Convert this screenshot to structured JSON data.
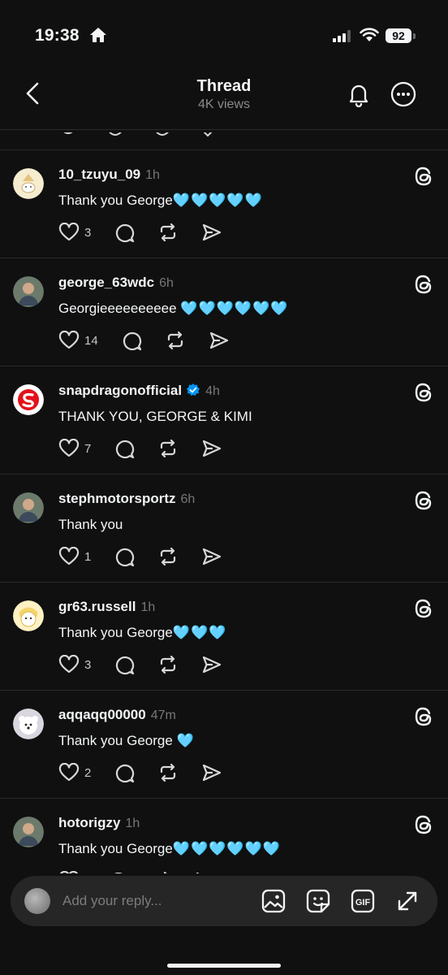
{
  "status": {
    "time": "19:38",
    "battery": "92"
  },
  "nav": {
    "title": "Thread",
    "subtitle": "4K views"
  },
  "posts": [
    {
      "username": "10_tzuyu_09",
      "time": "1h",
      "verified": false,
      "text": "Thank you George",
      "hearts": "🩵🩵🩵🩵🩵",
      "likes": "3",
      "avatar": "avatar-sketch"
    },
    {
      "username": "george_63wdc",
      "time": "6h",
      "verified": false,
      "text": "Georgieeeeeeeeee ",
      "hearts": "🩵🩵🩵🩵🩵🩵",
      "likes": "14",
      "avatar": "avatar-photo"
    },
    {
      "username": "snapdragonofficial",
      "time": "4h",
      "verified": true,
      "text": "THANK YOU, GEORGE & KIMI",
      "hearts": "",
      "likes": "7",
      "avatar": "snapdragon-logo"
    },
    {
      "username": "stephmotorsportz",
      "time": "6h",
      "verified": false,
      "text": "Thank you",
      "hearts": "",
      "likes": "1",
      "avatar": "avatar-photo"
    },
    {
      "username": "gr63.russell",
      "time": "1h",
      "verified": false,
      "text": "Thank you George",
      "hearts": "🩵🩵🩵",
      "likes": "3",
      "avatar": "avatar-cartoon"
    },
    {
      "username": "aqqaqq00000",
      "time": "47m",
      "verified": false,
      "text": "Thank you George ",
      "hearts": "🩵",
      "likes": "2",
      "avatar": "avatar-dog"
    },
    {
      "username": "hotorigzy",
      "time": "1h",
      "verified": false,
      "text": "Thank you George",
      "hearts": "🩵🩵🩵🩵🩵🩵",
      "likes": "",
      "avatar": "avatar-photo"
    }
  ],
  "reply": {
    "placeholder": "Add your reply...",
    "gif_label": "GIF"
  },
  "colors": {
    "background": "#101010",
    "text": "#f3f5f7",
    "muted": "#777777",
    "heart": "#5bc8f0",
    "verified": "#0095f6",
    "snapdragon": "#e3111b"
  }
}
